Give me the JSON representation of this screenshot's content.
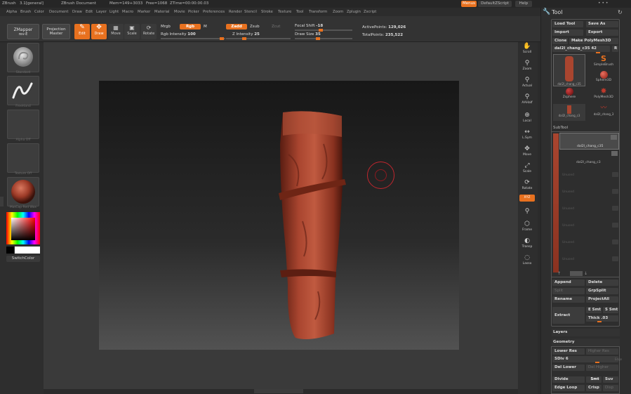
{
  "titlebar": {
    "app": "ZBrush",
    "version": "3.1[general]",
    "document": "ZBrush Document",
    "mem": "Mem=149+3033",
    "free": "Free=1068",
    "ztime": "ZTime=00:00:00.03",
    "menus_btn": "Menus",
    "script_btn": "DefaultZScript",
    "help_btn": "Help"
  },
  "menubar": [
    "Alpha",
    "Brush",
    "Color",
    "Document",
    "Draw",
    "Edit",
    "Layer",
    "Light",
    "Macro",
    "Marker",
    "Material",
    "Movie",
    "Picker",
    "Preferences",
    "Render",
    "Stencil",
    "Stroke",
    "Texture",
    "Tool",
    "Transform",
    "Zoom",
    "Zplugin",
    "Zscript"
  ],
  "shelf": {
    "zmapper": "ZMapper",
    "zmapper_rev": "rev-E",
    "projection": "Projection",
    "projection2": "Master",
    "edit": "Edit",
    "draw": "Draw",
    "move": "Move",
    "scale": "Scale",
    "rotate": "Rotate",
    "mrgb": "Mrgb",
    "rgb": "Rgb",
    "m": "M",
    "rgb_intensity_label": "Rgb Intensity",
    "rgb_intensity": "100",
    "zadd": "Zadd",
    "zsub": "Zsub",
    "zcut": "Zcut",
    "z_intensity_label": "Z Intensity",
    "z_intensity": "25",
    "focal_shift_label": "Focal Shift",
    "focal_shift": "-18",
    "draw_size_label": "Draw Size",
    "draw_size": "35",
    "active_points_label": "ActivePoints:",
    "active_points": "129,026",
    "total_points_label": "TotalPoints:",
    "total_points": "235,522"
  },
  "lefttray": {
    "brush": "Standard",
    "stroke": "FreeHand",
    "alpha": "Alpha Off",
    "texture": "Texture Off",
    "material": "MatCap Red Wax",
    "switch_color": "SwitchColor"
  },
  "righttray": [
    "Scroll",
    "Zoom",
    "Actual",
    "AAHalf",
    "Local",
    "L.Sym",
    "Move",
    "Scale",
    "Rotate",
    "XYZ",
    "Frame",
    "Transp",
    "Lasso"
  ],
  "tool": {
    "title": "Tool",
    "load_tool": "Load Tool",
    "save_as": "Save As",
    "import": "Import",
    "export": "Export",
    "clone": "Clone",
    "make_polymesh": "Make PolyMesh3D",
    "current_tool": "dal2l_chang_c35",
    "current_count": "42",
    "r": "R",
    "thumbs": [
      "dal2l_chang_c35",
      "SimpleBrush",
      "Sphere3D",
      "Zsphere",
      "PolyMesh3D",
      "dal2l_chang_c3",
      "dal2l_chang_3"
    ],
    "subtool_label": "SubTool",
    "subtools": [
      "dal2l_chang_c35",
      "dal2l_chang_c3"
    ],
    "empty_slot": "Unused",
    "append": "Append",
    "delete": "Delete",
    "split": "Split",
    "grpsplit": "GrpSplit",
    "rename": "Rename",
    "projectall": "ProjectAll",
    "extract": "Extract",
    "e_smt": "E Smt",
    "s_smt": "S Smt",
    "thick_label": "Thick",
    "thick": ".03",
    "layers": "Layers",
    "geometry": "Geometry",
    "lower_res": "Lower Res",
    "higher_res": "Higher Res",
    "sdiv_label": "SDiv",
    "sdiv": "6",
    "edge": "Edge",
    "del_lower": "Del Lower",
    "del_higher": "Del Higher",
    "divide": "Divide",
    "smt": "Smt",
    "suv": "Suv",
    "edge_loop": "Edge Loop",
    "crisp": "Crisp",
    "disp": "Disp"
  }
}
